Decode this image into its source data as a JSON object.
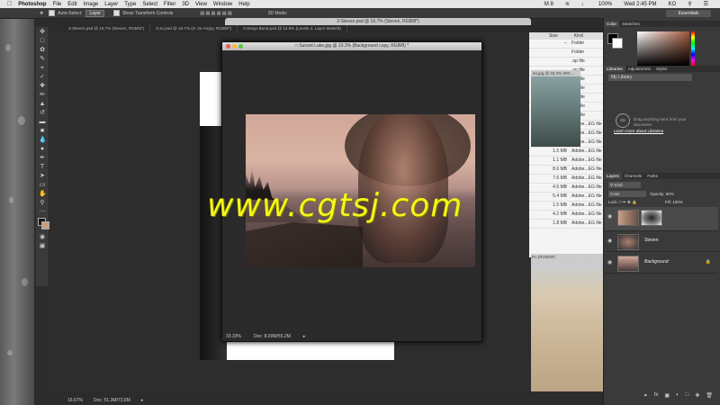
{
  "menubar": {
    "app_name": "Photoshop",
    "items": [
      "File",
      "Edit",
      "Image",
      "Layer",
      "Type",
      "Select",
      "Filter",
      "3D",
      "View",
      "Window",
      "Help"
    ],
    "right_status": "M 8",
    "battery": "100%",
    "clock": "Wed 2:45 PM",
    "user": "KO"
  },
  "options_bar": {
    "auto_select_label": "Auto-Select:",
    "auto_select_value": "Layer",
    "transform_label": "Show Transform Controls",
    "mode_3d": "3D Mode:",
    "workspace": "Essentials"
  },
  "tabs": [
    "2-Steven.psd @ 16.7% (Steven, RGB/8*)",
    "3-Jo.psd @ 16.7% (3--Jo-Angry, RGB/8*)",
    "3-Sergo Bond.psd @ 12.5% (Levels 2, Layer Mask/8)"
  ],
  "background_window_title": "2-Steven.psd @ 16.7% (Steven, RGB/8*)",
  "sunset_window": {
    "title": "Sunset Lake.jpg @ 33.3% (Background copy, RGB/8) *",
    "zoom": "33.33%",
    "doc_size": "Doc: 8.00M/55.2M"
  },
  "main_status": {
    "zoom": "16.67%",
    "doc_size": "Doc: 51.3M/73.6M"
  },
  "finder": {
    "headers": [
      "Size",
      "Kind"
    ],
    "rows": [
      {
        "size": "--",
        "kind": "Folder"
      },
      {
        "size": "",
        "kind": "Folder"
      },
      {
        "size": "",
        "kind": ".op file"
      },
      {
        "size": "",
        "kind": ".op file"
      },
      {
        "size": "",
        "kind": ".op file"
      },
      {
        "size": "",
        "kind": ".op file"
      },
      {
        "size": "",
        "kind": ".op file"
      },
      {
        "size": "",
        "kind": "EG file"
      },
      {
        "size": "",
        "kind": "EG file"
      },
      {
        "size": "10.7 MB",
        "kind": "Adobe...EG file"
      },
      {
        "size": "8.6 MB",
        "kind": "Adobe...EG file"
      },
      {
        "size": "11.9 MB",
        "kind": "Adobe...EG file"
      },
      {
        "size": "1.5 MB",
        "kind": "Adobe...EG file"
      },
      {
        "size": "1.1 MB",
        "kind": "Adobe...EG file"
      },
      {
        "size": "8.6 MB",
        "kind": "Adobe...EG file"
      },
      {
        "size": "7.6 MB",
        "kind": "Adobe...EG file"
      },
      {
        "size": "4.5 MB",
        "kind": "Adobe...EG file"
      },
      {
        "size": "5.4 MB",
        "kind": "Adobe...EG file"
      },
      {
        "size": "1.5 MB",
        "kind": "Adobe...EG file"
      },
      {
        "size": "4.2 MB",
        "kind": "Adobe...EG file"
      },
      {
        "size": "1.8 MB",
        "kind": "Adobe...EG file"
      }
    ],
    "forest_title": "ter.jpg @ 33.3% (RG...",
    "dunes_title": "3% (RGB/8#)"
  },
  "panels": {
    "color_tabs": [
      "Color",
      "Swatches"
    ],
    "library_tabs": [
      "Libraries",
      "Adjustments",
      "Styles"
    ],
    "library_select": "My Library",
    "library_message": "Drag anything here from your document",
    "library_link": "Learn more about Libraries",
    "layers_tabs": [
      "Layers",
      "Channels",
      "Paths"
    ],
    "kind_label": "Kind",
    "blend_mode": "Color",
    "opacity_label": "Opacity:",
    "opacity_value": "50%",
    "lock_label": "Lock:",
    "fill_label": "Fill:",
    "fill_value": "100%",
    "layers": [
      {
        "name": ""
      },
      {
        "name": "Steven"
      },
      {
        "name": "Background"
      }
    ]
  },
  "watermark": "www.cgtsj.com",
  "colors": {
    "watermark": "#f5f518",
    "panel_bg": "#3a3a3a",
    "menubar": "#e6e6e6"
  }
}
